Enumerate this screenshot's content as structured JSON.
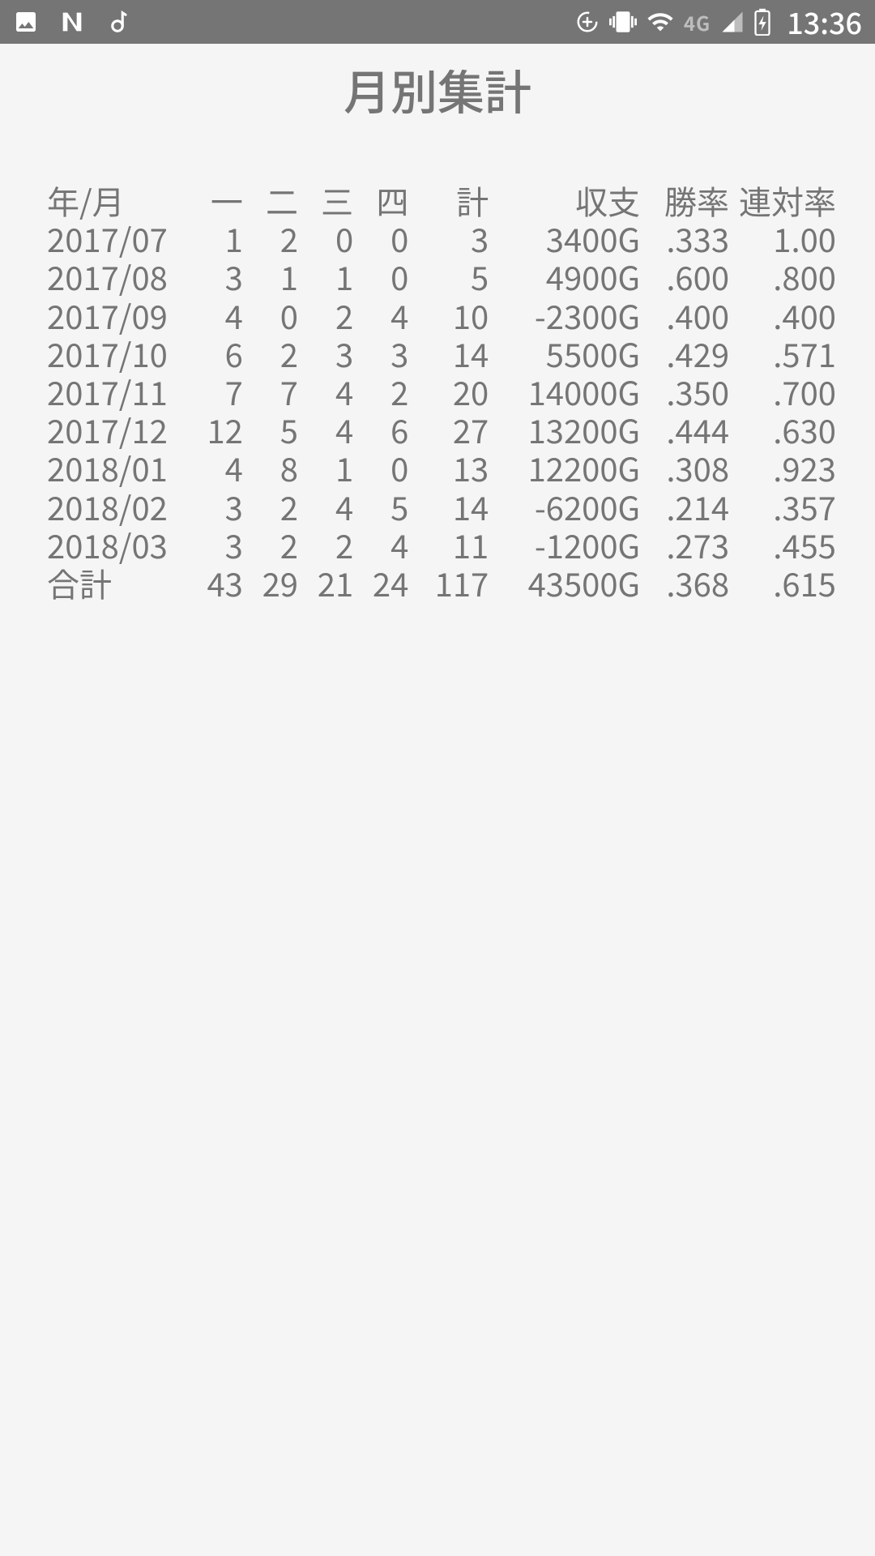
{
  "status": {
    "network": "4G",
    "time": "13:36"
  },
  "title": "月別集計",
  "headers": {
    "ym": "年/月",
    "c1": "一",
    "c2": "二",
    "c3": "三",
    "c4": "四",
    "total": "計",
    "balance": "収支",
    "winrate": "勝率",
    "rentai": "連対率"
  },
  "rows": [
    {
      "ym": "2017/07",
      "c1": "1",
      "c2": "2",
      "c3": "0",
      "c4": "0",
      "total": "3",
      "balance": "3400G",
      "winrate": ".333",
      "rentai": "1.00"
    },
    {
      "ym": "2017/08",
      "c1": "3",
      "c2": "1",
      "c3": "1",
      "c4": "0",
      "total": "5",
      "balance": "4900G",
      "winrate": ".600",
      "rentai": ".800"
    },
    {
      "ym": "2017/09",
      "c1": "4",
      "c2": "0",
      "c3": "2",
      "c4": "4",
      "total": "10",
      "balance": "-2300G",
      "winrate": ".400",
      "rentai": ".400"
    },
    {
      "ym": "2017/10",
      "c1": "6",
      "c2": "2",
      "c3": "3",
      "c4": "3",
      "total": "14",
      "balance": "5500G",
      "winrate": ".429",
      "rentai": ".571"
    },
    {
      "ym": "2017/11",
      "c1": "7",
      "c2": "7",
      "c3": "4",
      "c4": "2",
      "total": "20",
      "balance": "14000G",
      "winrate": ".350",
      "rentai": ".700"
    },
    {
      "ym": "2017/12",
      "c1": "12",
      "c2": "5",
      "c3": "4",
      "c4": "6",
      "total": "27",
      "balance": "13200G",
      "winrate": ".444",
      "rentai": ".630"
    },
    {
      "ym": "2018/01",
      "c1": "4",
      "c2": "8",
      "c3": "1",
      "c4": "0",
      "total": "13",
      "balance": "12200G",
      "winrate": ".308",
      "rentai": ".923"
    },
    {
      "ym": "2018/02",
      "c1": "3",
      "c2": "2",
      "c3": "4",
      "c4": "5",
      "total": "14",
      "balance": "-6200G",
      "winrate": ".214",
      "rentai": ".357"
    },
    {
      "ym": "2018/03",
      "c1": "3",
      "c2": "2",
      "c3": "2",
      "c4": "4",
      "total": "11",
      "balance": "-1200G",
      "winrate": ".273",
      "rentai": ".455"
    }
  ],
  "total_row": {
    "ym": "合計",
    "c1": "43",
    "c2": "29",
    "c3": "21",
    "c4": "24",
    "total": "117",
    "balance": "43500G",
    "winrate": ".368",
    "rentai": ".615"
  }
}
